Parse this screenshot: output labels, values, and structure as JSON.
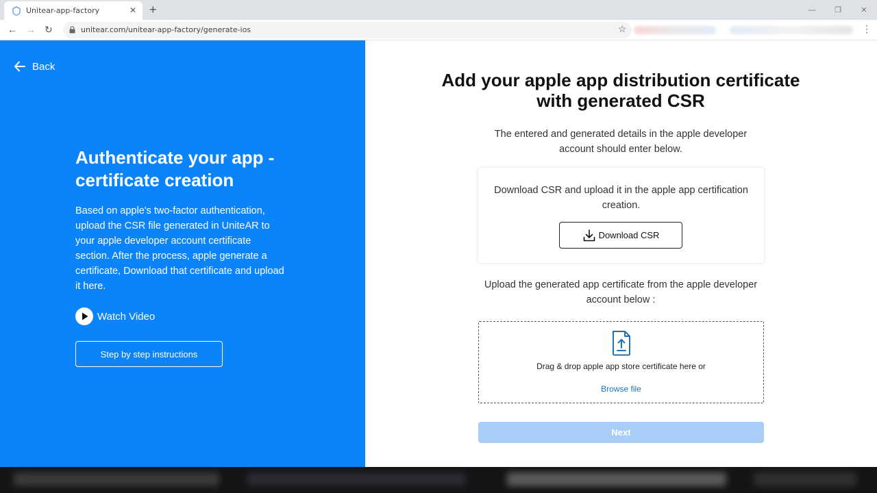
{
  "browser": {
    "tab_title": "Unitear-app-factory",
    "tab_close": "✕",
    "new_tab": "+",
    "url": "unitear.com/unitear-app-factory/generate-ios",
    "back_glyph": "←",
    "forward_glyph": "→",
    "reload_glyph": "↻",
    "star_glyph": "☆",
    "menu_glyph": "⋮",
    "minimize_glyph": "—",
    "maximize_glyph": "❐",
    "close_glyph": "✕"
  },
  "left": {
    "back_label": "Back",
    "title": "Authenticate your app - certificate creation",
    "description": "Based on apple's two-factor authentication, upload the CSR file generated in UniteAR to your apple developer account certificate section. After the process, apple generate a certificate, Download that certificate and upload it here.",
    "watch_video_label": "Watch Video",
    "steps_button_label": "Step by step instructions"
  },
  "right": {
    "title": "Add your apple app distribution certificate with generated CSR",
    "subtitle": "The entered and generated details in the apple developer account should enter below.",
    "csr_text": "Download CSR and upload it in the apple app certification creation.",
    "download_button_label": "Download CSR",
    "upload_label": "Upload the generated app certificate from the apple developer account below :",
    "drop_text": "Drag & drop apple app store certificate here or",
    "browse_label": "Browse file",
    "next_button_label": "Next"
  },
  "colors": {
    "brand_blue": "#0a84f8",
    "next_disabled": "#a9cdf6",
    "browse_link": "#1a73b8"
  },
  "icons": [
    "back-arrow-icon",
    "play-icon",
    "download-icon",
    "upload-file-icon",
    "lock-icon",
    "star-icon",
    "app-favicon-icon",
    "cursor-icon"
  ]
}
